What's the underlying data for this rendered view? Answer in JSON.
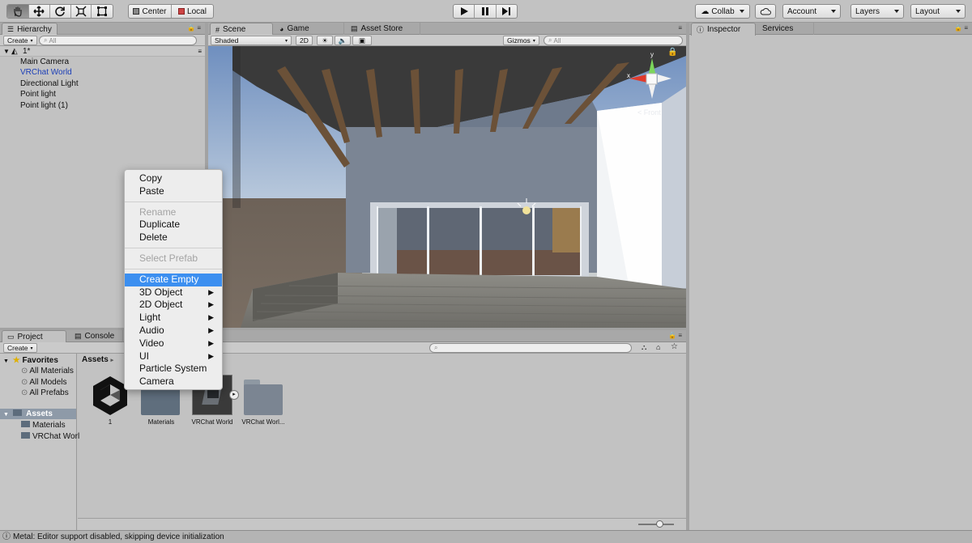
{
  "toolbar": {
    "pivot_label": "Center",
    "space_label": "Local",
    "collab_label": "Collab",
    "account_label": "Account",
    "layers_label": "Layers",
    "layout_label": "Layout"
  },
  "hierarchy": {
    "tab_label": "Hierarchy",
    "create_label": "Create",
    "search_placeholder": "All",
    "scene_name": "1*",
    "items": [
      {
        "label": "Main Camera",
        "color": "#111111"
      },
      {
        "label": "VRChat World",
        "color": "#1c3fb8"
      },
      {
        "label": "Directional Light",
        "color": "#111111"
      },
      {
        "label": "Point light",
        "color": "#111111"
      },
      {
        "label": "Point light (1)",
        "color": "#111111"
      }
    ]
  },
  "scene": {
    "tabs": [
      "Scene",
      "Game",
      "Asset Store"
    ],
    "shading_mode": "Shaded",
    "mode_2d": "2D",
    "gizmos_label": "Gizmos",
    "search_placeholder": "All",
    "gizmo_axes": {
      "x": "x",
      "y": "y"
    },
    "gizmo_view": "Front"
  },
  "inspector": {
    "tabs": [
      "Inspector",
      "Services"
    ]
  },
  "context_menu": {
    "groups": [
      [
        {
          "label": "Copy"
        },
        {
          "label": "Paste"
        }
      ],
      [
        {
          "label": "Rename",
          "disabled": true
        },
        {
          "label": "Duplicate"
        },
        {
          "label": "Delete"
        }
      ],
      [
        {
          "label": "Select Prefab",
          "disabled": true
        }
      ],
      [
        {
          "label": "Create Empty",
          "highlighted": true
        },
        {
          "label": "3D Object",
          "submenu": true
        },
        {
          "label": "2D Object",
          "submenu": true
        },
        {
          "label": "Light",
          "submenu": true
        },
        {
          "label": "Audio",
          "submenu": true
        },
        {
          "label": "Video",
          "submenu": true
        },
        {
          "label": "UI",
          "submenu": true
        },
        {
          "label": "Particle System"
        },
        {
          "label": "Camera"
        }
      ]
    ]
  },
  "project": {
    "tabs": [
      "Project",
      "Console"
    ],
    "create_label": "Create",
    "favorites_label": "Favorites",
    "favorites": [
      "All Materials",
      "All Models",
      "All Prefabs"
    ],
    "assets_label": "Assets",
    "asset_folders": [
      "Materials",
      "VRChat Worl"
    ],
    "breadcrumb": "Assets",
    "assets": [
      "1",
      "Materials",
      "VRChat World",
      "VRChat Worl..."
    ]
  },
  "status": {
    "message": "Metal: Editor support disabled, skipping device initialization"
  },
  "colors": {
    "accent": "#3c8ff0",
    "panel_bg": "#c2c2c2",
    "menu_bg": "#ededed"
  }
}
